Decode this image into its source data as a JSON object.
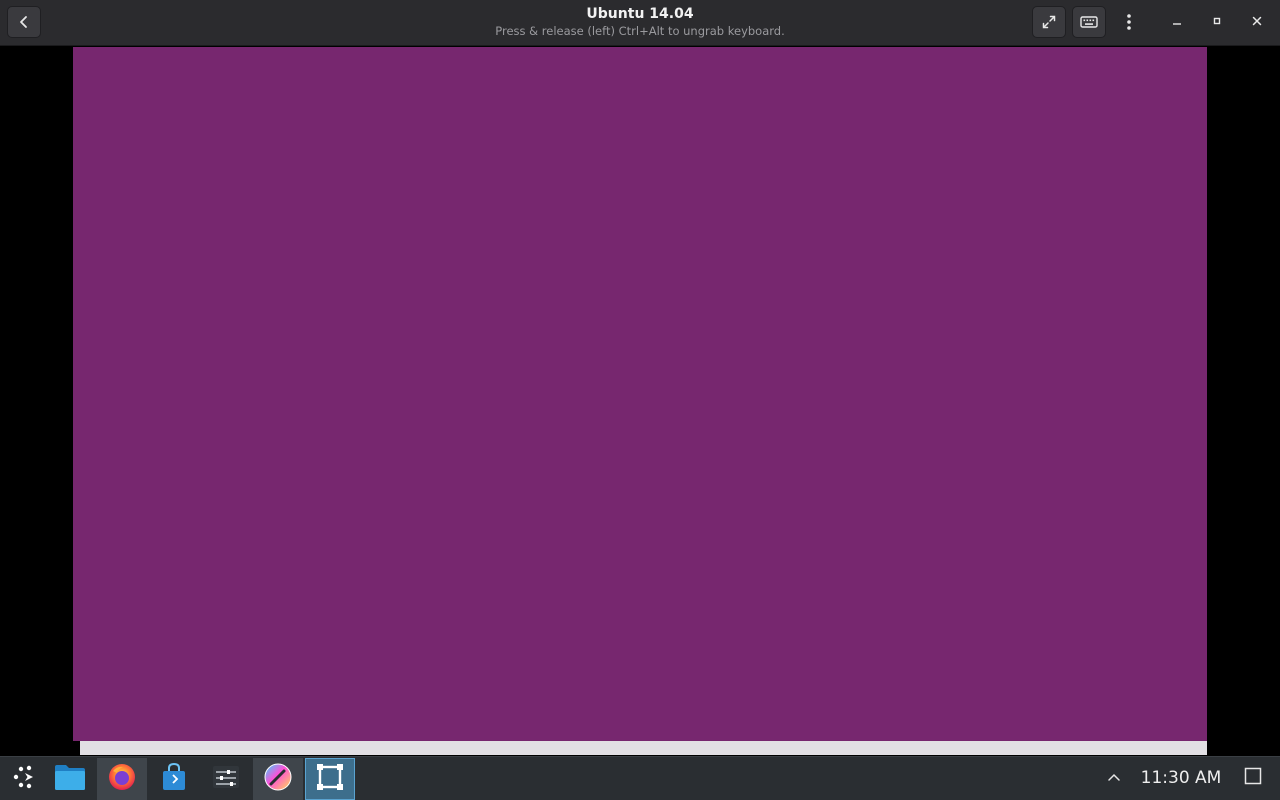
{
  "window": {
    "title": "Ubuntu 14.04",
    "subtitle": "Press & release (left) Ctrl+Alt to ungrab keyboard."
  },
  "header_buttons": {
    "back": "back-arrow-icon",
    "fullscreen": "fullscreen-icon",
    "keyboard": "keyboard-icon",
    "menu": "kebab-menu-icon",
    "minimize": "minimize-icon",
    "maximize": "maximize-icon",
    "close": "close-icon"
  },
  "vm_display": {
    "background_color": "#77276f"
  },
  "taskbar": {
    "items": [
      {
        "name": "application-launcher",
        "icon": "launcher-icon",
        "state": "idle"
      },
      {
        "name": "files",
        "icon": "folder-icon",
        "state": "idle"
      },
      {
        "name": "firefox",
        "icon": "firefox-icon",
        "state": "running"
      },
      {
        "name": "software-store",
        "icon": "store-bag-icon",
        "state": "idle"
      },
      {
        "name": "settings",
        "icon": "sliders-icon",
        "state": "idle"
      },
      {
        "name": "krita",
        "icon": "krita-icon",
        "state": "running"
      },
      {
        "name": "boxes",
        "icon": "boxes-icon",
        "state": "active"
      }
    ],
    "tray_expand_icon": "chevron-up-icon",
    "clock": "11:30 AM",
    "show_desktop_icon": "show-desktop-icon"
  },
  "colors": {
    "header_bg": "#2b2b2e",
    "vm_bg": "#77276f",
    "taskbar_bg": "#2a2e32",
    "active_task": "#3d6e8c"
  }
}
